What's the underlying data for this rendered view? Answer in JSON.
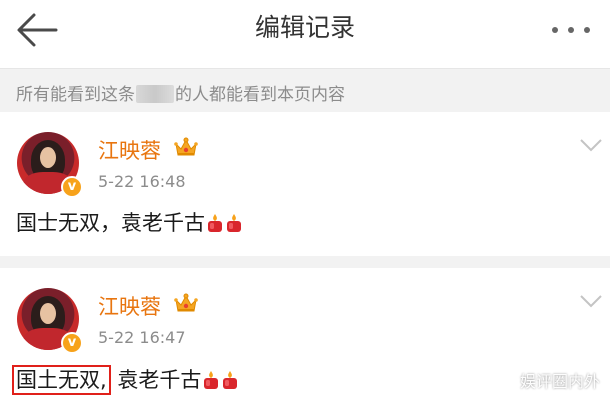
{
  "header": {
    "title": "编辑记录",
    "back_icon": "arrow-left-icon",
    "more_icon": "more-dots-icon"
  },
  "notice": {
    "text_before": "所有能看到这条",
    "text_after": "的人都能看到本页内容"
  },
  "records": [
    {
      "username": "江映蓉",
      "timestamp": "5-22 16:48",
      "content": "国士无双，袁老千古",
      "content_highlight": "",
      "content_rest": "国士无双，袁老千古",
      "emoji_count": 2
    },
    {
      "username": "江映蓉",
      "timestamp": "5-22 16:47",
      "content_highlight": "国土无双,",
      "content_rest": "袁老千古",
      "emoji_count": 2
    }
  ],
  "badge": {
    "vip_mark": "v"
  },
  "watermark": "娱评圈内外",
  "colors": {
    "username": "#e8750f",
    "highlight_border": "#e0201a",
    "notice_bg": "#f2f2f2",
    "vip_badge": "#f7a21b"
  }
}
